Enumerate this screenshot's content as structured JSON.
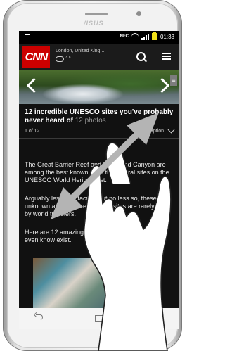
{
  "device": {
    "brand": "/ISUS"
  },
  "status_bar": {
    "nfc": "NFC",
    "time": "01:33",
    "battery_color": "#f2e21a"
  },
  "app_bar": {
    "logo": "CNN",
    "logo_color": "#cc0000",
    "location": "London, United King...",
    "temperature": "1°"
  },
  "gallery": {
    "side_handle": "≡",
    "title": "12 incredible UNESCO sites you've probably never heard of",
    "photo_count": "12 photos",
    "page_indicator": "1 of 12",
    "caption_toggle": "Hide caption"
  },
  "article": {
    "p1": "The Great Barrier Reef and the Grand Canyon are among the best known of all the natural sites on the UNESCO World Heritage list.",
    "p2": "Arguably less spectacular but no less so, these unknown and obscure heritage sites are rarely seen by world travelers.",
    "p3": "Here are 12 amazing UNESCO sites you might not even know exist."
  },
  "gesture": {
    "type": "pinch-zoom",
    "arrow_color": "#b4b4b4"
  }
}
